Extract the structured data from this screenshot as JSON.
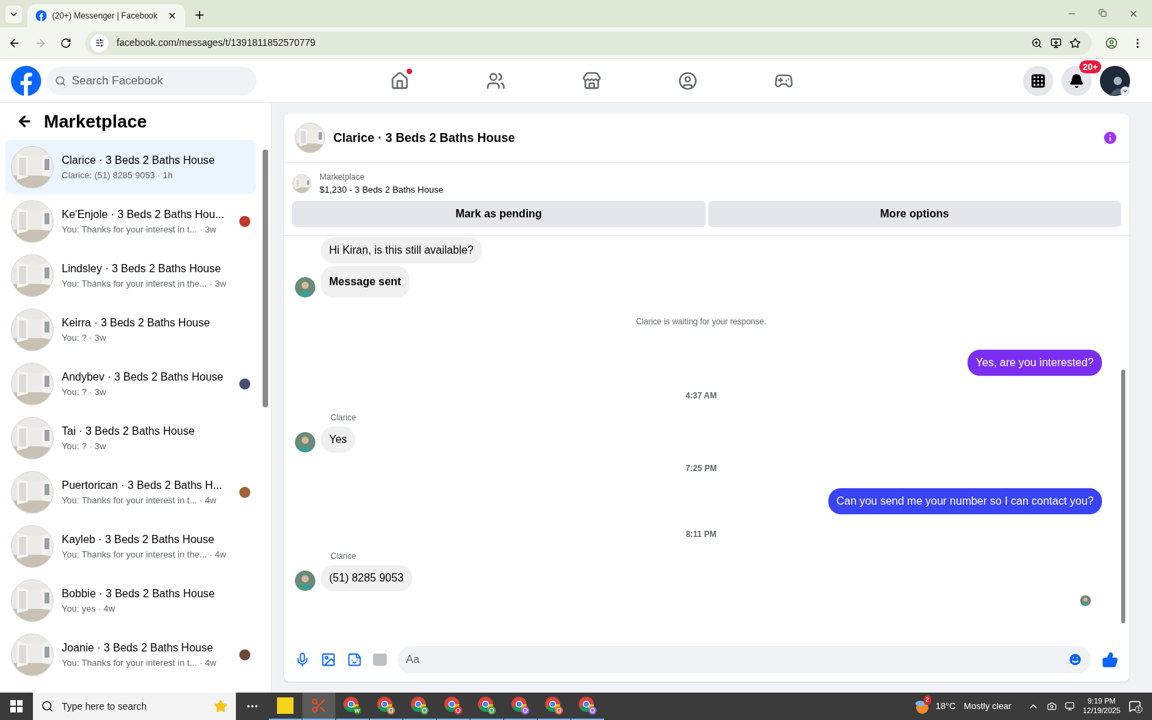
{
  "browser": {
    "tab_title": "(20+) Messenger | Facebook",
    "url": "facebook.com/messages/t/1391811852570779"
  },
  "header": {
    "search_placeholder": "Search Facebook",
    "notification_badge": "20+",
    "home_dot": true
  },
  "sidebar": {
    "title": "Marketplace",
    "items": [
      {
        "title": "Clarice · 3 Beds 2 Baths House",
        "preview": "Clarice: (51) 8285 9053 · 1h",
        "selected": true,
        "seen": false
      },
      {
        "title": "Ke'Enjole · 3 Beds 2 Baths Hou...",
        "preview": "You: Thanks for your interest in t... · 3w",
        "selected": false,
        "seen": true,
        "color": "#c0392b"
      },
      {
        "title": "Lindsley · 3 Beds 2 Baths House",
        "preview": "You: Thanks for your interest in the... · 3w",
        "selected": false,
        "seen": false
      },
      {
        "title": "Keirra · 3 Beds 2 Baths House",
        "preview": "You: ? · 3w",
        "selected": false,
        "seen": false
      },
      {
        "title": "Andybev · 3 Beds 2 Baths House",
        "preview": "You: ? · 3w",
        "selected": false,
        "seen": true,
        "color": "#4a4e6e"
      },
      {
        "title": "Tai · 3 Beds 2 Baths House",
        "preview": "You: ? · 3w",
        "selected": false,
        "seen": false
      },
      {
        "title": "Puertorican · 3 Beds 2 Baths H...",
        "preview": "You: Thanks for your interest in t... · 4w",
        "selected": false,
        "seen": true,
        "color": "#a0613a"
      },
      {
        "title": "Kayleb · 3 Beds 2 Baths House",
        "preview": "You: Thanks for your interest in the... · 4w",
        "selected": false,
        "seen": false
      },
      {
        "title": "Bobbie · 3 Beds 2 Baths House",
        "preview": "You: yes · 4w",
        "selected": false,
        "seen": false
      },
      {
        "title": "Joanie · 3 Beds 2 Baths House",
        "preview": "You: Thanks for your interest in t... · 4w",
        "selected": false,
        "seen": true,
        "color": "#6b4a3a"
      }
    ]
  },
  "chat": {
    "title": "Clarice · 3 Beds 2 Baths House",
    "listing_label": "Marketplace",
    "listing": "$1,230 - 3 Beds 2 Baths House",
    "actions": [
      "Mark as pending",
      "More options"
    ],
    "messages": [
      {
        "kind": "incoming",
        "text": "Hi Kiran, is this still available?",
        "avatar": false,
        "bold": false
      },
      {
        "kind": "incoming",
        "text": "Message sent",
        "avatar": true,
        "bold": true
      },
      {
        "kind": "notice",
        "text": "Clarice is waiting for your response."
      },
      {
        "kind": "outgoing",
        "text": "Yes, are you interested?",
        "color": "#7a2ff0"
      },
      {
        "kind": "time",
        "text": "4:37 AM"
      },
      {
        "kind": "incoming",
        "sender": "Clarice",
        "text": "Yes",
        "avatar": true,
        "bold": false
      },
      {
        "kind": "time",
        "text": "7:25 PM"
      },
      {
        "kind": "outgoing",
        "text": "Can you send me your number so I can contact you?",
        "color": "#3a44f2"
      },
      {
        "kind": "time",
        "text": "8:11 PM"
      },
      {
        "kind": "incoming",
        "sender": "Clarice",
        "text": "(51) 8285 9053",
        "avatar": true,
        "bold": false
      }
    ],
    "composer_placeholder": "Aa"
  },
  "taskbar": {
    "search_placeholder": "Type here to search",
    "apps": [
      {
        "kind": "sticky"
      },
      {
        "kind": "snip"
      },
      {
        "kind": "chrome",
        "badge": "W",
        "color": "#3a8a2a"
      },
      {
        "kind": "chrome",
        "color": "#b08a50"
      },
      {
        "kind": "chrome",
        "color": "#5aa05a"
      },
      {
        "kind": "chrome",
        "color": "#e0384a"
      },
      {
        "kind": "chrome",
        "color": "#5aa05a"
      },
      {
        "kind": "chrome",
        "color": "#9a6ad0"
      },
      {
        "kind": "chrome",
        "color": "#e06a4a"
      },
      {
        "kind": "chrome",
        "color": "#9a6ad0"
      }
    ],
    "weather_badge": "2",
    "weather": "18°C",
    "weather_text": "Mostly clear",
    "time": "9:19 PM",
    "date": "12/19/2025",
    "notifications": "1"
  }
}
